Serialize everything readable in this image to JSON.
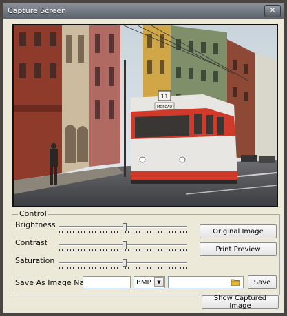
{
  "window": {
    "title": "Capture Screen",
    "close_glyph": "✕"
  },
  "video": {
    "tram_number": "11",
    "tram_sign": "MOSCAU"
  },
  "control": {
    "legend": "Control",
    "brightness": {
      "label": "Brightness",
      "value": 0.51
    },
    "contrast": {
      "label": "Contrast",
      "value": 0.51
    },
    "saturation": {
      "label": "Saturation",
      "value": 0.51
    }
  },
  "buttons": {
    "original_image": "Original Image",
    "print_preview": "Print Preview",
    "save": "Save",
    "show_captured": "Show Captured Image"
  },
  "save_as": {
    "label": "Save As Image Name :",
    "name_value": "",
    "format_selected": "BMP",
    "path_value": ""
  },
  "icons": {
    "dropdown": "dropdown-arrow-icon",
    "folder": "folder-icon",
    "close": "close-icon"
  }
}
